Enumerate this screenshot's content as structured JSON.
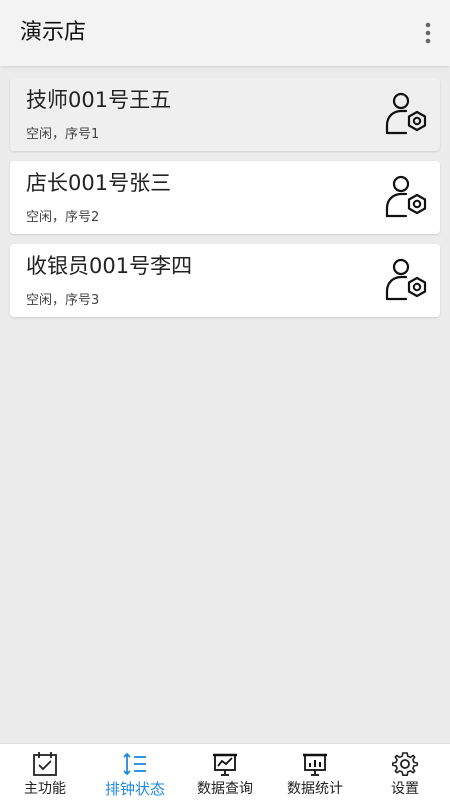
{
  "app_bar": {
    "title": "演示店",
    "menu_icon": "more-vert-icon"
  },
  "staff": [
    {
      "name": "技师001号王五",
      "status": "空闲，序号1",
      "icon": "user-settings-icon"
    },
    {
      "name": "店长001号张三",
      "status": "空闲，序号2",
      "icon": "user-settings-icon"
    },
    {
      "name": "收银员001号李四",
      "status": "空闲，序号3",
      "icon": "user-settings-icon"
    }
  ],
  "bottom_nav": {
    "items": [
      {
        "label": "主功能",
        "icon": "calendar-check-icon"
      },
      {
        "label": "排钟状态",
        "icon": "sort-list-icon"
      },
      {
        "label": "数据查询",
        "icon": "presentation-chart-icon"
      },
      {
        "label": "数据统计",
        "icon": "presentation-chart-icon"
      },
      {
        "label": "设置",
        "icon": "gear-icon"
      }
    ],
    "active_index": 1
  },
  "colors": {
    "background": "#ececec",
    "app_bar": "#f3f3f3",
    "card": "#ffffff",
    "card_selected": "#efefef",
    "accent": "#1e88e5"
  }
}
